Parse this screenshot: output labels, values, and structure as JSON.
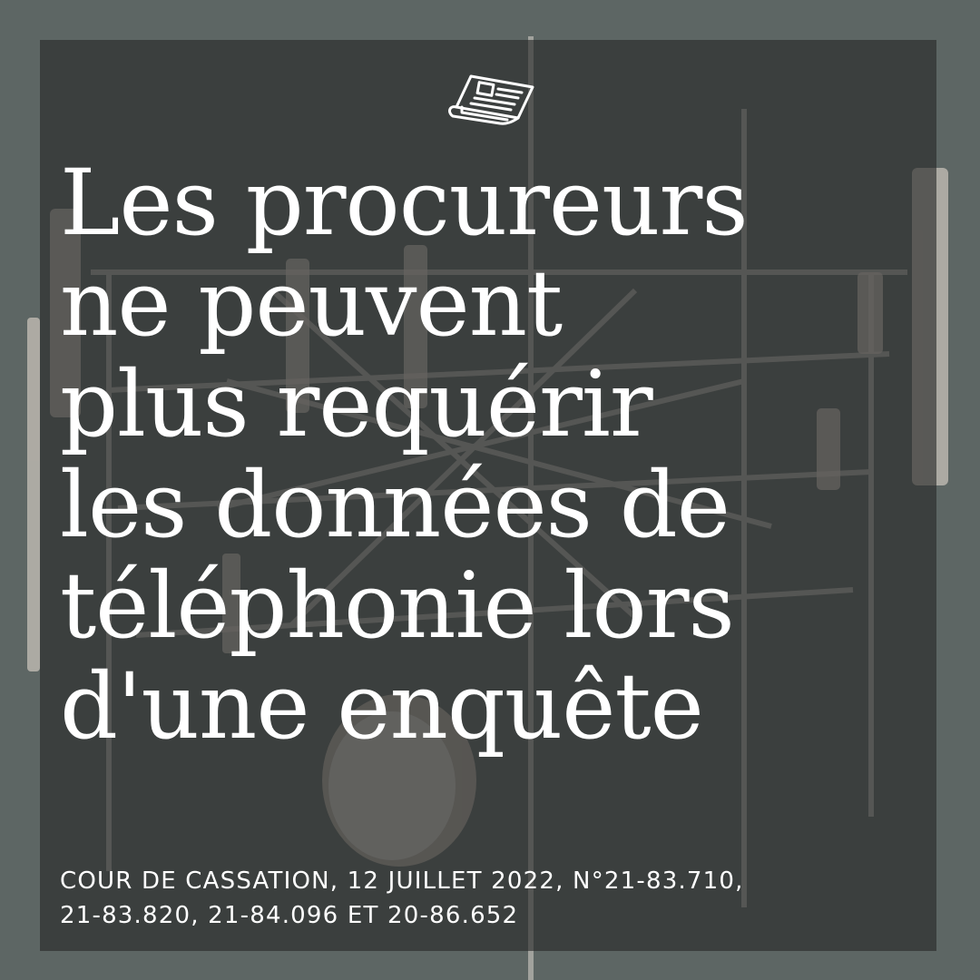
{
  "colors": {
    "background": "#5d6664",
    "overlay": "#262626",
    "text": "#ffffff"
  },
  "icon": "newspaper-icon",
  "headline": {
    "lines": [
      "Les procureurs",
      "ne peuvent",
      "plus requérir",
      "les données de",
      "téléphonie lors",
      "d'une enquête"
    ]
  },
  "caption": {
    "lines": [
      "COUR DE CASSATION, 12 JUILLET 2022, N°21-83.710,",
      "21-83.820, 21-84.096 ET 20-86.652"
    ]
  }
}
